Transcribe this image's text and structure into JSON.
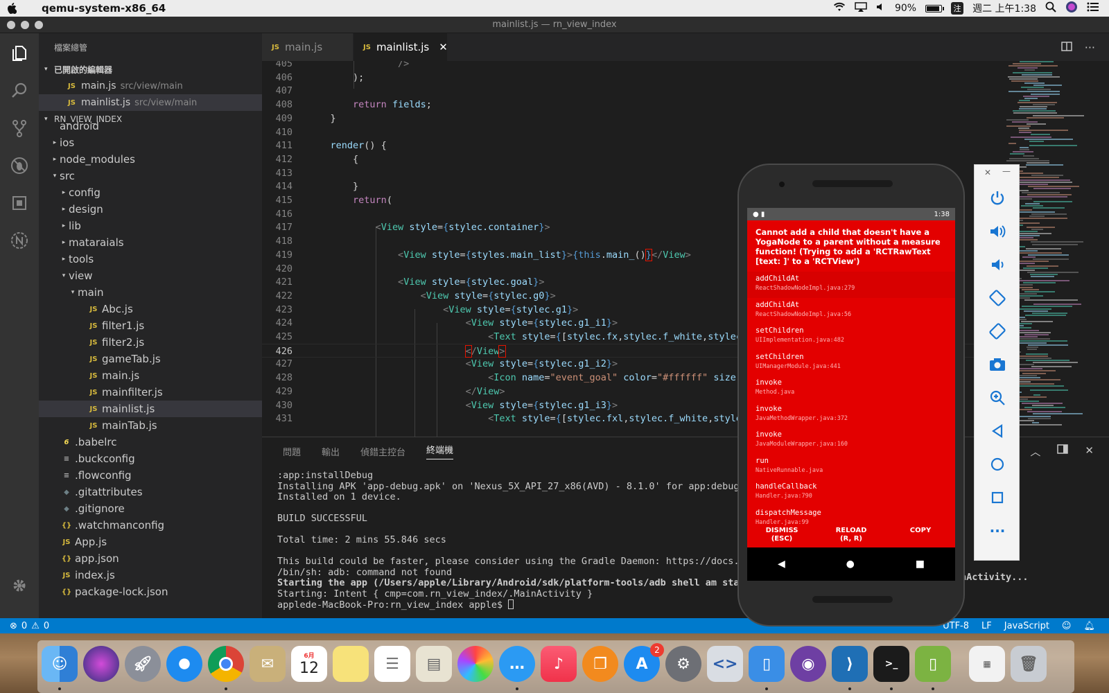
{
  "menubar": {
    "app_name": "qemu-system-x86_64",
    "battery": "90%",
    "ime": "注",
    "clock": "週二 上午1:38"
  },
  "window": {
    "title": "mainlist.js — rn_view_index"
  },
  "sidebar": {
    "title": "檔案總管",
    "open_editors_header": "已開啟的編輯器",
    "open_editors": [
      {
        "icon": "JS",
        "name": "main.js",
        "path": "src/view/main"
      },
      {
        "icon": "JS",
        "name": "mainlist.js",
        "path": "src/view/main"
      }
    ],
    "project_header": "RN_VIEW_INDEX",
    "tree": [
      {
        "name": "android",
        "arrow": "",
        "icon": "",
        "depth": 0
      },
      {
        "name": "ios",
        "arrow": "▸",
        "icon": "",
        "depth": 0
      },
      {
        "name": "node_modules",
        "arrow": "▸",
        "icon": "",
        "depth": 0
      },
      {
        "name": "src",
        "arrow": "▾",
        "icon": "",
        "depth": 0
      },
      {
        "name": "config",
        "arrow": "▸",
        "icon": "",
        "depth": 1
      },
      {
        "name": "design",
        "arrow": "▸",
        "icon": "",
        "depth": 1
      },
      {
        "name": "lib",
        "arrow": "▸",
        "icon": "",
        "depth": 1
      },
      {
        "name": "mataraials",
        "arrow": "▸",
        "icon": "",
        "depth": 1
      },
      {
        "name": "tools",
        "arrow": "▸",
        "icon": "",
        "depth": 1
      },
      {
        "name": "view",
        "arrow": "▾",
        "icon": "",
        "depth": 1
      },
      {
        "name": "main",
        "arrow": "▾",
        "icon": "",
        "depth": 2
      },
      {
        "name": "Abc.js",
        "arrow": "",
        "icon": "JS",
        "depth": 3
      },
      {
        "name": "filter1.js",
        "arrow": "",
        "icon": "JS",
        "depth": 3
      },
      {
        "name": "filter2.js",
        "arrow": "",
        "icon": "JS",
        "depth": 3
      },
      {
        "name": "gameTab.js",
        "arrow": "",
        "icon": "JS",
        "depth": 3
      },
      {
        "name": "main.js",
        "arrow": "",
        "icon": "JS",
        "depth": 3
      },
      {
        "name": "mainfilter.js",
        "arrow": "",
        "icon": "JS",
        "depth": 3
      },
      {
        "name": "mainlist.js",
        "arrow": "",
        "icon": "JS",
        "depth": 3
      },
      {
        "name": "mainTab.js",
        "arrow": "",
        "icon": "JS",
        "depth": 3
      },
      {
        "name": ".babelrc",
        "arrow": "",
        "icon": "6",
        "depth": 0
      },
      {
        "name": ".buckconfig",
        "arrow": "",
        "icon": "≡",
        "depth": 0
      },
      {
        "name": ".flowconfig",
        "arrow": "",
        "icon": "≡",
        "depth": 0
      },
      {
        "name": ".gitattributes",
        "arrow": "",
        "icon": "◆",
        "depth": 0
      },
      {
        "name": ".gitignore",
        "arrow": "",
        "icon": "◆",
        "depth": 0
      },
      {
        "name": ".watchmanconfig",
        "arrow": "",
        "icon": "{}",
        "depth": 0
      },
      {
        "name": "App.js",
        "arrow": "",
        "icon": "JS",
        "depth": 0
      },
      {
        "name": "app.json",
        "arrow": "",
        "icon": "{}",
        "depth": 0
      },
      {
        "name": "index.js",
        "arrow": "",
        "icon": "JS",
        "depth": 0
      },
      {
        "name": "package-lock.json",
        "arrow": "",
        "icon": "{}",
        "depth": 0
      }
    ]
  },
  "tabs": [
    {
      "icon": "JS",
      "label": "main.js"
    },
    {
      "icon": "JS",
      "label": "mainlist.js",
      "close": "✕"
    }
  ],
  "editor": {
    "current_line": "426",
    "lines": [
      {
        "n": "405",
        "html": "                <span class=\"tg\">/&gt;</span>"
      },
      {
        "n": "406",
        "html": "        );"
      },
      {
        "n": "407",
        "html": ""
      },
      {
        "n": "408",
        "html": "        <span class=\"kw\">return</span> <span class=\"at\">fields</span>;"
      },
      {
        "n": "409",
        "html": "    }"
      },
      {
        "n": "410",
        "html": ""
      },
      {
        "n": "411",
        "html": "    <span class=\"at\">render</span>() {"
      },
      {
        "n": "412",
        "html": "        {"
      },
      {
        "n": "413",
        "html": ""
      },
      {
        "n": "414",
        "html": "        }"
      },
      {
        "n": "415",
        "html": "        <span class=\"kw\">return</span>("
      },
      {
        "n": "416",
        "html": ""
      },
      {
        "n": "417",
        "html": "            <span class=\"tg\">&lt;</span><span class=\"tn\">View</span> <span class=\"at\">style</span>=<span class=\"ex\">{</span><span class=\"at\">stylec.container</span><span class=\"ex\">}</span><span class=\"tg\">&gt;</span>"
      },
      {
        "n": "418",
        "html": ""
      },
      {
        "n": "419",
        "html": "                <span class=\"tg\">&lt;</span><span class=\"tn\">View</span> <span class=\"at\">style</span>=<span class=\"ex\">{</span><span class=\"at\">styles.main_list</span><span class=\"ex\">}</span><span class=\"tg\">&gt;</span><span class=\"ex\">{</span><span class=\"ex\">this</span>.<span class=\"at\">main_</span>()<span class=\"mark\"><span class=\"ex\">}</span></span><span class=\"tg\">&lt;/</span><span class=\"tn\">View</span><span class=\"tg\">&gt;</span>"
      },
      {
        "n": "420",
        "html": ""
      },
      {
        "n": "421",
        "html": "                <span class=\"tg\">&lt;</span><span class=\"tn\">View</span> <span class=\"at\">style</span>=<span class=\"ex\">{</span><span class=\"at\">stylec.goal</span><span class=\"ex\">}</span><span class=\"tg\">&gt;</span>"
      },
      {
        "n": "422",
        "html": "                    <span class=\"tg\">&lt;</span><span class=\"tn\">View</span> <span class=\"at\">style</span>=<span class=\"ex\">{</span><span class=\"at\">stylec.g0</span><span class=\"ex\">}</span><span class=\"tg\">&gt;</span>"
      },
      {
        "n": "423",
        "html": "                        <span class=\"tg\">&lt;</span><span class=\"tn\">View</span> <span class=\"at\">style</span>=<span class=\"ex\">{</span><span class=\"at\">stylec.g1</span><span class=\"ex\">}</span><span class=\"tg\">&gt;</span>"
      },
      {
        "n": "424",
        "html": "                            <span class=\"tg\">&lt;</span><span class=\"tn\">View</span> <span class=\"at\">style</span>=<span class=\"ex\">{</span><span class=\"at\">stylec.g1_i1</span><span class=\"ex\">}</span><span class=\"tg\">&gt;</span>"
      },
      {
        "n": "425",
        "html": "                                <span class=\"tg\">&lt;</span><span class=\"tn\">Text</span> <span class=\"at\">style</span>=<span class=\"ex\">{</span>[<span class=\"at\">stylec.fx</span>,<span class=\"at\">stylec.f_white</span>,<span class=\"at\">stylec</span>"
      },
      {
        "n": "426",
        "html": "                            <span class=\"mark\"><span class=\"tg\">&lt;</span></span><span class=\"tg\">/</span><span class=\"tn\">View</span><span class=\"mark\"><span class=\"tg\">&gt;</span></span>"
      },
      {
        "n": "427",
        "html": "                            <span class=\"tg\">&lt;</span><span class=\"tn\">View</span> <span class=\"at\">style</span>=<span class=\"ex\">{</span><span class=\"at\">stylec.g1_i2</span><span class=\"ex\">}</span><span class=\"tg\">&gt;</span>"
      },
      {
        "n": "428",
        "html": "                                <span class=\"tg\">&lt;</span><span class=\"tn\">Icon</span> <span class=\"at\">name</span>=<span class=\"st\">\"event_goal\"</span> <span class=\"at\">color</span>=<span class=\"st\">\"#ffffff\"</span> <span class=\"at\">size</span>"
      },
      {
        "n": "429",
        "html": "                            <span class=\"tg\">&lt;/</span><span class=\"tn\">View</span><span class=\"tg\">&gt;</span>"
      },
      {
        "n": "430",
        "html": "                            <span class=\"tg\">&lt;</span><span class=\"tn\">View</span> <span class=\"at\">style</span>=<span class=\"ex\">{</span><span class=\"at\">stylec.g1_i3</span><span class=\"ex\">}</span><span class=\"tg\">&gt;</span>"
      },
      {
        "n": "431",
        "html": "                                <span class=\"tg\">&lt;</span><span class=\"tn\">Text</span> <span class=\"at\">style</span>=<span class=\"ex\">{</span>[<span class=\"at\">stylec.fxl</span>,<span class=\"at\">stylec.f_white</span>,<span class=\"at\">stylec</span>"
      }
    ]
  },
  "panel": {
    "tabs": [
      "問題",
      "輸出",
      "偵錯主控台",
      "終端機"
    ],
    "active_tab": 3,
    "terminal": [
      {
        "t": ":app:installDebug",
        "b": false
      },
      {
        "t": "Installing APK 'app-debug.apk' on 'Nexus_5X_API_27_x86(AVD) - 8.1.0' for app:debug",
        "b": false
      },
      {
        "t": "Installed on 1 device.",
        "b": false
      },
      {
        "t": "",
        "b": false
      },
      {
        "t": "BUILD SUCCESSFUL",
        "b": false
      },
      {
        "t": "",
        "b": false
      },
      {
        "t": "Total time: 2 mins 55.846 secs",
        "b": false
      },
      {
        "t": "",
        "b": false
      },
      {
        "t": "This build could be faster, please consider using the Gradle Daemon: https://docs.gra",
        "b": false
      },
      {
        "t": "/bin/sh: adb: command not found",
        "b": false
      },
      {
        "t": "Starting the app (/Users/apple/Library/Android/sdk/platform-tools/adb shell am start -",
        "b": true
      },
      {
        "t": "Starting: Intent { cmp=com.rn_view_index/.MainActivity }",
        "b": false
      },
      {
        "t": "applede-MacBook-Pro:rn_view_index apple$ ",
        "b": false
      }
    ],
    "tail_l": "l",
    "tail_activity": "nActivity..."
  },
  "statusbar": {
    "errors": "0",
    "warnings": "0",
    "encoding": "UTF-8",
    "eol": "LF",
    "language": "JavaScript"
  },
  "emulator": {
    "status_time": "1:38",
    "error_title": "Cannot add a child that doesn't have a YogaNode to a parent without a measure function! (Trying to add a 'RCTRawText [text: ]' to a 'RCTView')",
    "frames": [
      {
        "fn": "addChildAt",
        "file": "ReactShadowNodeImpl.java:279"
      },
      {
        "fn": "addChildAt",
        "file": "ReactShadowNodeImpl.java:56"
      },
      {
        "fn": "setChildren",
        "file": "UIImplementation.java:482"
      },
      {
        "fn": "setChildren",
        "file": "UIManagerModule.java:441"
      },
      {
        "fn": "invoke",
        "file": "Method.java"
      },
      {
        "fn": "invoke",
        "file": "JavaMethodWrapper.java:372"
      },
      {
        "fn": "invoke",
        "file": "JavaModuleWrapper.java:160"
      },
      {
        "fn": "run",
        "file": "NativeRunnable.java"
      },
      {
        "fn": "handleCallback",
        "file": "Handler.java:790"
      },
      {
        "fn": "dispatchMessage",
        "file": "Handler.java:99"
      }
    ],
    "dismiss": "DISMISS",
    "dismiss_key": "(ESC)",
    "reload": "RELOAD",
    "reload_key": "(R, R)",
    "copy": "COPY"
  },
  "dock": {
    "calendar_month": "6月",
    "calendar_day": "12",
    "appstore_badge": "2"
  }
}
